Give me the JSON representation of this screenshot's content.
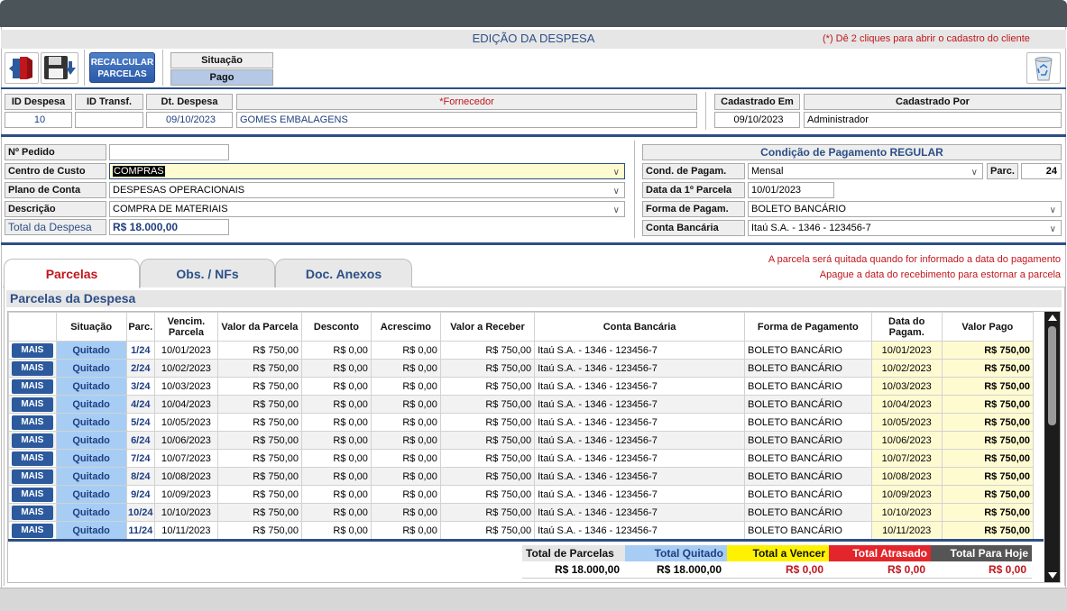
{
  "title": "EDIÇÃO DA DESPESA",
  "hint": "(*) Dê 2 cliques para abrir o cadastro do cliente",
  "toolbar": {
    "recalc_label_1": "RECALCULAR",
    "recalc_label_2": "PARCELAS",
    "situacao_label": "Situação",
    "situacao_value": "Pago"
  },
  "header": {
    "id_despesa_label": "ID Despesa",
    "id_despesa": "10",
    "id_transf_label": "ID Transf.",
    "id_transf": "",
    "dt_despesa_label": "Dt. Despesa",
    "dt_despesa": "09/10/2023",
    "fornecedor_label": "*Fornecedor",
    "fornecedor": "GOMES EMBALAGENS",
    "cadastrado_em_label": "Cadastrado Em",
    "cadastrado_em": "09/10/2023",
    "cadastrado_por_label": "Cadastrado Por",
    "cadastrado_por": "Administrador"
  },
  "left_form": {
    "pedido_label": "Nº Pedido",
    "pedido": "",
    "centro_label": "Centro de Custo",
    "centro": "COMPRAS",
    "plano_label": "Plano de Conta",
    "plano": "DESPESAS OPERACIONAIS",
    "descricao_label": "Descrição",
    "descricao": "COMPRA DE MATERIAIS",
    "total_label": "Total da Despesa",
    "total": "R$ 18.000,00"
  },
  "right_form": {
    "section_title": "Condição de Pagamento REGULAR",
    "cond_label": "Cond. de Pagam.",
    "cond": "Mensal",
    "parc_label": "Parc.",
    "parc": "24",
    "data_label": "Data da 1º Parcela",
    "data": "10/01/2023",
    "forma_label": "Forma de Pagam.",
    "forma": "BOLETO BANCÁRIO",
    "conta_label": "Conta Bancária",
    "conta": "Itaú S.A. - 1346 - 123456-7"
  },
  "tabs": [
    "Parcelas",
    "Obs. / NFs",
    "Doc. Anexos"
  ],
  "notes": {
    "line1": "A parcela será quitada quando for informado a data do pagamento",
    "line2": "Apague a data do recebimento para estornar a parcela"
  },
  "section_heading": "Parcelas da Despesa",
  "grid": {
    "headers": [
      "",
      "Situação",
      "Parc.",
      "Vencim. Parcela",
      "Valor da Parcela",
      "Desconto",
      "Acrescimo",
      "Valor a Receber",
      "Conta Bancária",
      "Forma de Pagamento",
      "Data do Pagam.",
      "Valor Pago"
    ],
    "rows": [
      [
        "MAIS",
        "Quitado",
        "1/24",
        "10/01/2023",
        "R$ 750,00",
        "R$ 0,00",
        "R$ 0,00",
        "R$ 750,00",
        "Itaú S.A. - 1346 - 123456-7",
        "BOLETO BANCÁRIO",
        "10/01/2023",
        "R$ 750,00"
      ],
      [
        "MAIS",
        "Quitado",
        "2/24",
        "10/02/2023",
        "R$ 750,00",
        "R$ 0,00",
        "R$ 0,00",
        "R$ 750,00",
        "Itaú S.A. - 1346 - 123456-7",
        "BOLETO BANCÁRIO",
        "10/02/2023",
        "R$ 750,00"
      ],
      [
        "MAIS",
        "Quitado",
        "3/24",
        "10/03/2023",
        "R$ 750,00",
        "R$ 0,00",
        "R$ 0,00",
        "R$ 750,00",
        "Itaú S.A. - 1346 - 123456-7",
        "BOLETO BANCÁRIO",
        "10/03/2023",
        "R$ 750,00"
      ],
      [
        "MAIS",
        "Quitado",
        "4/24",
        "10/04/2023",
        "R$ 750,00",
        "R$ 0,00",
        "R$ 0,00",
        "R$ 750,00",
        "Itaú S.A. - 1346 - 123456-7",
        "BOLETO BANCÁRIO",
        "10/04/2023",
        "R$ 750,00"
      ],
      [
        "MAIS",
        "Quitado",
        "5/24",
        "10/05/2023",
        "R$ 750,00",
        "R$ 0,00",
        "R$ 0,00",
        "R$ 750,00",
        "Itaú S.A. - 1346 - 123456-7",
        "BOLETO BANCÁRIO",
        "10/05/2023",
        "R$ 750,00"
      ],
      [
        "MAIS",
        "Quitado",
        "6/24",
        "10/06/2023",
        "R$ 750,00",
        "R$ 0,00",
        "R$ 0,00",
        "R$ 750,00",
        "Itaú S.A. - 1346 - 123456-7",
        "BOLETO BANCÁRIO",
        "10/06/2023",
        "R$ 750,00"
      ],
      [
        "MAIS",
        "Quitado",
        "7/24",
        "10/07/2023",
        "R$ 750,00",
        "R$ 0,00",
        "R$ 0,00",
        "R$ 750,00",
        "Itaú S.A. - 1346 - 123456-7",
        "BOLETO BANCÁRIO",
        "10/07/2023",
        "R$ 750,00"
      ],
      [
        "MAIS",
        "Quitado",
        "8/24",
        "10/08/2023",
        "R$ 750,00",
        "R$ 0,00",
        "R$ 0,00",
        "R$ 750,00",
        "Itaú S.A. - 1346 - 123456-7",
        "BOLETO BANCÁRIO",
        "10/08/2023",
        "R$ 750,00"
      ],
      [
        "MAIS",
        "Quitado",
        "9/24",
        "10/09/2023",
        "R$ 750,00",
        "R$ 0,00",
        "R$ 0,00",
        "R$ 750,00",
        "Itaú S.A. - 1346 - 123456-7",
        "BOLETO BANCÁRIO",
        "10/09/2023",
        "R$ 750,00"
      ],
      [
        "MAIS",
        "Quitado",
        "10/24",
        "10/10/2023",
        "R$ 750,00",
        "R$ 0,00",
        "R$ 0,00",
        "R$ 750,00",
        "Itaú S.A. - 1346 - 123456-7",
        "BOLETO BANCÁRIO",
        "10/10/2023",
        "R$ 750,00"
      ],
      [
        "MAIS",
        "Quitado",
        "11/24",
        "10/11/2023",
        "R$ 750,00",
        "R$ 0,00",
        "R$ 0,00",
        "R$ 750,00",
        "Itaú S.A. - 1346 - 123456-7",
        "BOLETO BANCÁRIO",
        "10/11/2023",
        "R$ 750,00"
      ]
    ]
  },
  "totals": [
    {
      "label": "Total de Parcelas",
      "value": "R$ 18.000,00",
      "bg": "#e6e6e6",
      "fg": "#111111",
      "vfg": "#000000"
    },
    {
      "label": "Total Quitado",
      "value": "R$ 18.000,00",
      "bg": "#a7cdf5",
      "fg": "#1f3f80",
      "vfg": "#000000"
    },
    {
      "label": "Total a Vencer",
      "value": "R$ 0,00",
      "bg": "#fff200",
      "fg": "#111111",
      "vfg": "#c0161c"
    },
    {
      "label": "Total Atrasado",
      "value": "R$ 0,00",
      "bg": "#e3262b",
      "fg": "#ffffff",
      "vfg": "#c0161c"
    },
    {
      "label": "Total Para Hoje",
      "value": "R$ 0,00",
      "bg": "#555555",
      "fg": "#ffffff",
      "vfg": "#c0161c"
    }
  ],
  "icons": [
    "exit-door-icon",
    "save-floppy-icon",
    "recycle-bin-icon",
    "chevron-down-icon"
  ]
}
